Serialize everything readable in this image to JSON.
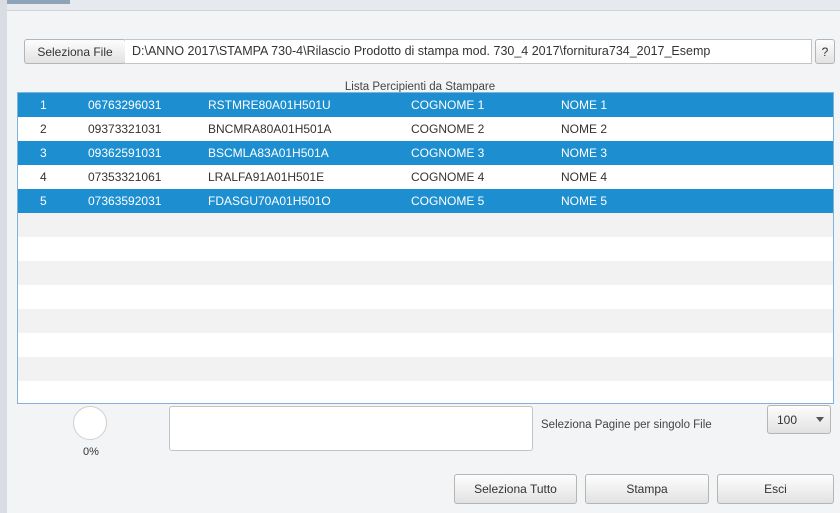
{
  "file": {
    "select_label": "Seleziona File",
    "path": "D:\\ANNO 2017\\STAMPA  730-4\\Rilascio Prodotto di stampa mod. 730_4 2017\\fornitura734_2017_Esemp",
    "help_label": "?"
  },
  "list": {
    "title": "Lista Percipienti da Stampare",
    "rows": [
      {
        "num": "1",
        "code": "06763296031",
        "cf": "RSTMRE80A01H501U",
        "cognome": "COGNOME 1",
        "nome": "NOME 1",
        "selected": true
      },
      {
        "num": "2",
        "code": "09373321031",
        "cf": "BNCMRA80A01H501A",
        "cognome": "COGNOME 2",
        "nome": "NOME 2",
        "selected": false
      },
      {
        "num": "3",
        "code": "09362591031",
        "cf": "BSCMLA83A01H501A",
        "cognome": "COGNOME 3",
        "nome": "NOME 3",
        "selected": true
      },
      {
        "num": "4",
        "code": "07353321061",
        "cf": "LRALFA91A01H501E",
        "cognome": "COGNOME 4",
        "nome": "NOME 4",
        "selected": false
      },
      {
        "num": "5",
        "code": "07363592031",
        "cf": "FDASGU70A01H501O",
        "cognome": "COGNOME 5",
        "nome": "NOME 5",
        "selected": true
      }
    ]
  },
  "progress": {
    "value": 0,
    "label": "0%"
  },
  "pages": {
    "label": "Seleziona Pagine per singolo File",
    "selected": "100"
  },
  "actions": {
    "select_all": "Seleziona Tutto",
    "print": "Stampa",
    "exit": "Esci"
  }
}
